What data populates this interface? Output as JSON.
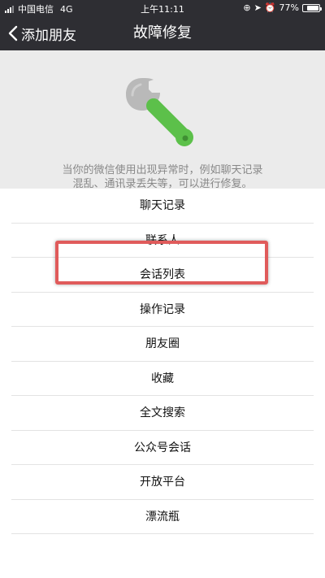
{
  "status_bar": {
    "carrier": "中国电信",
    "network": "4G",
    "time": "上午11:11",
    "battery": "77%",
    "battery_level": 0.77
  },
  "nav": {
    "back_label": "添加朋友",
    "title": "故障修复"
  },
  "header": {
    "icon": "wrench-icon",
    "description_line1": "当你的微信使用出现异常时，例如聊天记录",
    "description_line2": "混乱、通讯录丢失等，可以进行修复。"
  },
  "list": {
    "items": [
      "聊天记录",
      "联系人",
      "会话列表",
      "操作记录",
      "朋友圈",
      "收藏",
      "全文搜索",
      "公众号会话",
      "开放平台",
      "漂流瓶"
    ]
  },
  "colors": {
    "nav_bg": "#2e2e33",
    "wrench_green": "#5cc04a",
    "highlight_red": "#e05b5b"
  }
}
